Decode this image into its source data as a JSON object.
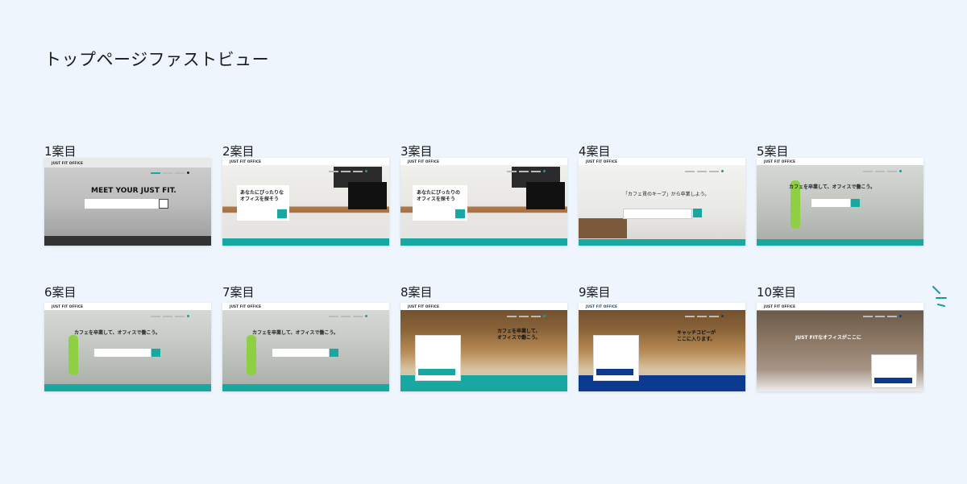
{
  "page_title": "トップページファストビュー",
  "proposals": [
    {
      "label": "1案目",
      "headline": "MEET YOUR JUST FIT."
    },
    {
      "label": "2案目",
      "headline": "あなたにぴったりな\nオフィスを探そう"
    },
    {
      "label": "3案目",
      "headline": "あなたにぴったりの\nオフィスを探そう"
    },
    {
      "label": "4案目",
      "headline": "「カフェ賃のキープ」から卒業しよう。"
    },
    {
      "label": "5案目",
      "headline": "カフェを卒業して、オフィスで働こう。"
    },
    {
      "label": "6案目",
      "headline": "カフェを卒業して、オフィスで働こう。"
    },
    {
      "label": "7案目",
      "headline": "カフェを卒業して、オフィスで働こう。"
    },
    {
      "label": "8案目",
      "headline": "カフェを卒業して、\nオフィスで働こう。"
    },
    {
      "label": "9案目",
      "headline": "キャッチコピーが\nここに入ります。"
    },
    {
      "label": "10案目",
      "headline": "JUST FITなオフィスがここに"
    }
  ],
  "logo_text": "JUST FIT OFFICE",
  "colors": {
    "accent": "#19a7a1",
    "navy": "#0b3a8e",
    "background": "#eef5fd"
  },
  "decoration_icon": "sparkle-lines-icon"
}
